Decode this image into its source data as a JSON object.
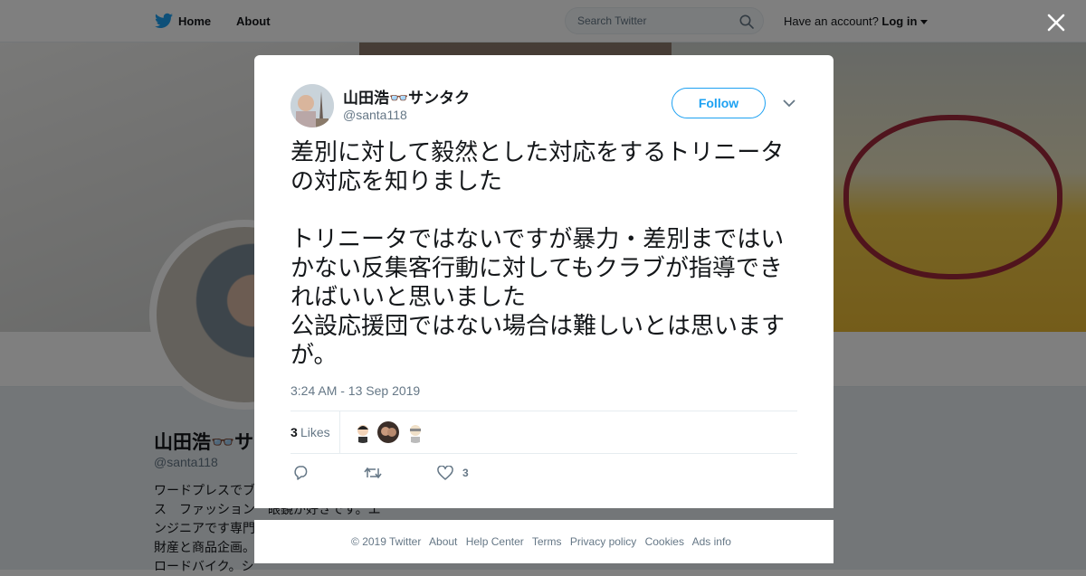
{
  "topbar": {
    "home_label": "Home",
    "about_label": "About",
    "search_placeholder": "Search Twitter",
    "account_text": "Have an account?",
    "login_label": "Log in"
  },
  "background_profile": {
    "name": "山田浩👓サ",
    "handle": "@santa118",
    "bio": "ワードプレスでブ\nス　ファッション　眼鏡が好きです。エ\nンジニアです専門\n財産と商品企画。\nロードバイク。シ"
  },
  "tweet": {
    "author_name": "山田浩👓サンタク",
    "author_handle": "@santa118",
    "follow_label": "Follow",
    "text": "差別に対して毅然とした対応をするトリニータの対応を知りました\n\nトリニータではないですが暴力・差別まではいかない反集客行動に対してもクラブが指導できればいいと思いました\n公設応援団ではない場合は難しいとは思いますが。",
    "timestamp": "3:24 AM - 13 Sep 2019",
    "likes_count": "3",
    "likes_label": "Likes",
    "action_like_count": "3"
  },
  "footer": {
    "links": [
      "© 2019 Twitter",
      "About",
      "Help Center",
      "Terms",
      "Privacy policy",
      "Cookies",
      "Ads info"
    ]
  },
  "colors": {
    "brand_blue": "#1da1f2",
    "text_primary": "#14171a",
    "text_secondary": "#657786"
  },
  "icons": [
    "twitter-bird-icon",
    "search-icon",
    "close-icon",
    "chevron-down-icon",
    "reply-icon",
    "retweet-icon",
    "heart-icon"
  ]
}
